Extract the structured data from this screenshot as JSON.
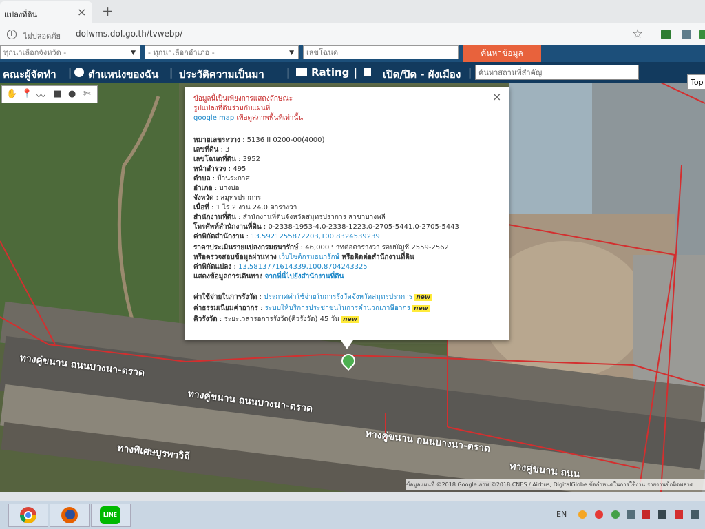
{
  "browser": {
    "tab_title": "แปลงที่ดิน",
    "new_tab": "+",
    "close": "×",
    "not_secure": "ไม่ปลอดภัย",
    "url": "dolwms.dol.go.th/tvwebp/"
  },
  "toolbar": {
    "province_select": "ทุกนาเลือกจังหวัด -",
    "amphoe_select": "- ทุกนาเลือกอำเภอ -",
    "deed_input_placeholder": "เลขโฉนด",
    "search_button": "ค้นหาข้อมูล"
  },
  "menu": {
    "items": [
      "คณะผู้จัดทำ",
      "ตำแหน่งของฉัน",
      "ประวัติความเป็นมา",
      "Rating",
      "เปิด/ปิด - ผังเมือง"
    ],
    "place_search_placeholder": "ค้นหาสถานที่สำคัญ",
    "topo_button": "Top"
  },
  "popup": {
    "disclaimer_line1": "ข้อมูลนี้เป็นเพียงการแสดงลักษณะ",
    "disclaimer_line2": "รูปแปลงที่ดินร่วมกับแผนที่",
    "disclaimer_line3a": "google map",
    "disclaimer_line3b": "เพื่อดูสภาพพื้นที่เท่านั้น",
    "rows": [
      {
        "label": "หมายเลขระวาง",
        "value": " : 5136 II 0200-00(4000)"
      },
      {
        "label": "เลขที่ดิน",
        "value": " : 3"
      },
      {
        "label": "เลขโฉนดที่ดิน",
        "value": " : 3952"
      },
      {
        "label": "หน้าสำรวจ",
        "value": " : 495"
      },
      {
        "label": "ตำบล",
        "value": " : บ้านระกาศ"
      },
      {
        "label": "อำเภอ",
        "value": " : บางบ่อ"
      },
      {
        "label": "จังหวัด",
        "value": " : สมุทรปราการ"
      },
      {
        "label": "เนื้อที่",
        "value": " : 1 ไร่ 2 งาน 24.0 ตารางวา"
      },
      {
        "label": "สำนักงานที่ดิน",
        "value": " : สำนักงานที่ดินจังหวัดสมุทรปราการ สาขาบางพลี"
      },
      {
        "label": "โทรศัพท์สำนักงานที่ดิน",
        "value": " : 0-2338-1953-4,0-2338-1223,0-2705-5441,0-2705-5443"
      }
    ],
    "office_coord_label": "ค่าพิกัดสำนักงาน",
    "office_coord_value": "13.5921255872203,100.8324539239",
    "price_label": "ราคาประเมินรายแปลงกรมธนารักษ์",
    "price_value": " : 46,000 บาทต่อตารางวา รอบบัญชี 2559-2562",
    "check_label": "หรือตรวจสอบข้อมูลผ่านทาง",
    "check_link": "เว็บไซต์กรมธนารักษ์",
    "check_suffix": "หรือติดต่อสำนักงานที่ดิน",
    "parcel_coord_label": "ค่าพิกัดแปลง",
    "parcel_coord_value": "13.5813771614339,100.8704243325",
    "route_label": "แสดงข้อมูลการเดินทาง",
    "route_link": "จากที่นี่ไปยังสำนักงานที่ดิน",
    "fee_label": "ค่าใช้จ่ายในการรังวัด",
    "fee_link": "ประกาศค่าใช้จ่ายในการรังวัดจังหวัดสมุทรปราการ",
    "tax_label": "ค่าธรรมเนียมค่าอากร",
    "tax_link": "ระบบให้บริการประชาชนในการคำนวณภาษีอากร",
    "queue_label": "คิวรังวัด",
    "queue_value": " : ระยะเวลารอการรังวัด(คิวรังวัด) 45 วัน",
    "new_badge": "new",
    "close": "×"
  },
  "map": {
    "road_labels": [
      "ทางคู่ขนาน ถนนบางนา-ตราด",
      "ทางคู่ขนาน ถนนบางนา-ตราด",
      "ทางพิเศษบูรพาวิถี",
      "ทางคู่ขนาน ถนนบางนา-ตราด",
      "ทางคู่ขนาน ถนน"
    ],
    "attribution": "ข้อมูลแผนที่ ©2018 Google ภาพ ©2018 CNES / Airbus, DigitalGlobe  ข้อกำหนดในการใช้งาน  รายงานข้อผิดพลาด"
  },
  "taskbar": {
    "lang": "EN",
    "apps": [
      "chrome-app",
      "firefox-app",
      "line-app"
    ],
    "line_label": "LINE"
  },
  "colors": {
    "toolbar_blue": "#1c4f7a",
    "menu_blue": "#123a5e",
    "search_orange": "#e8623c",
    "parcel_red": "#d32f2f"
  }
}
